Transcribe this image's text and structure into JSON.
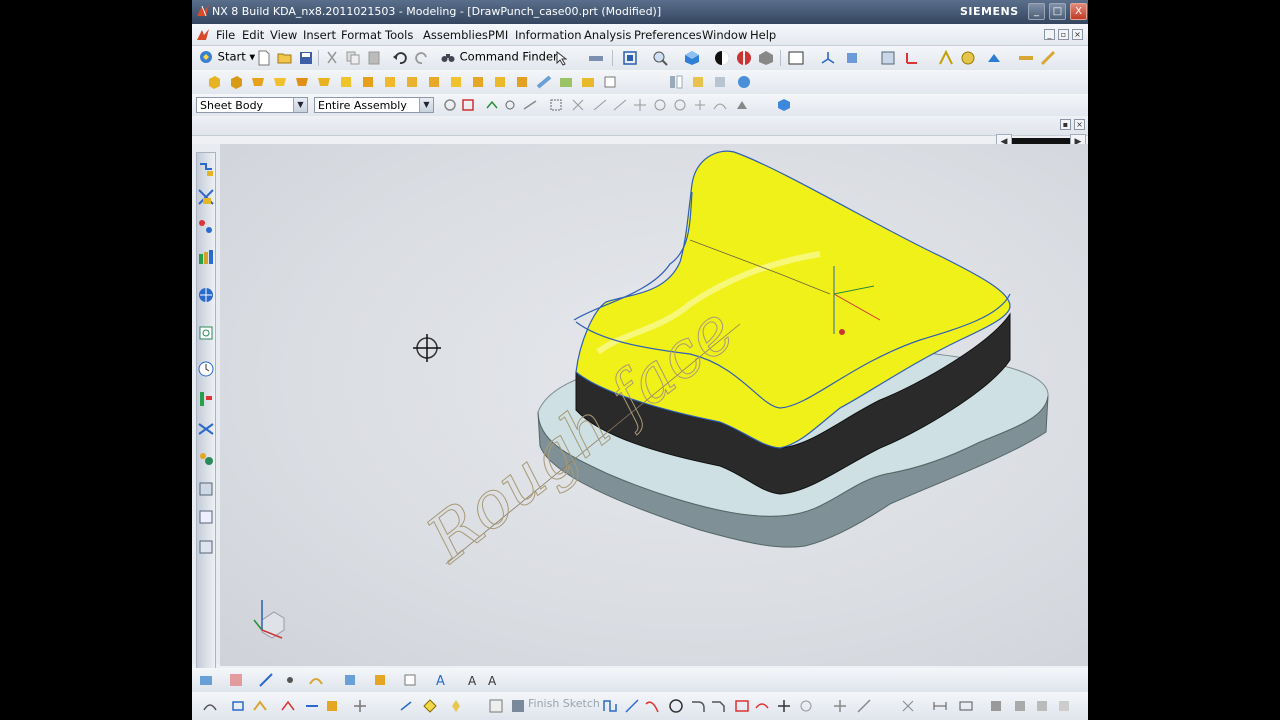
{
  "window": {
    "title": "NX 8  Build KDA_nx8.2011021503 - Modeling - [DrawPunch_case00.prt (Modified)]",
    "brand": "SIEMENS",
    "controls": [
      "_",
      "□",
      "X"
    ]
  },
  "menu": {
    "items": [
      "File",
      "Edit",
      "View",
      "Insert",
      "Format",
      "Tools",
      "Assemblies",
      "PMI",
      "Information",
      "Analysis",
      "Preferences",
      "Window",
      "Help"
    ]
  },
  "toolbar": {
    "start_label": "Start",
    "command_finder_label": "Command Finder"
  },
  "selection": {
    "type_filter": "Sheet Body",
    "scope": "Entire Assembly"
  },
  "sketch_toolbar": {
    "finish_sketch_label": "Finish Sketch"
  },
  "model": {
    "sketch_text": "Rough face"
  },
  "colors": {
    "punch_face": "#f1f11a",
    "punch_side": "#2a2a2a",
    "base_plate": "#c9dde1",
    "edge_curve": "#2f5fb5",
    "title_bar": "#3d4f69"
  },
  "icons": {
    "resource_bar": [
      "assembly-navigator-icon",
      "constraint-navigator-icon",
      "part-navigator-icon",
      "reuse-library-icon",
      "web-browser-icon",
      "history-icon",
      "system-materials-icon",
      "hd3d-tools-icon",
      "process-studio-icon",
      "roles-icon",
      "system-scenes-icon",
      "manufacturing-wizards-icon",
      "training-icon"
    ]
  }
}
